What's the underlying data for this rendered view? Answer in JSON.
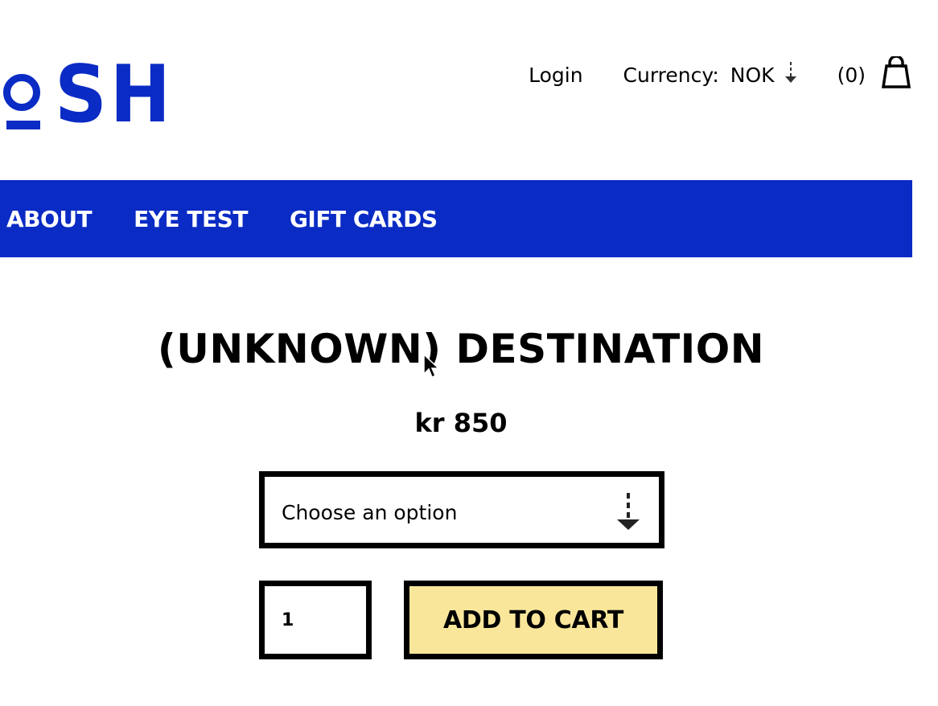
{
  "brand": {
    "logo_text": "SH",
    "color": "#0a2bc4"
  },
  "header": {
    "login_label": "Login",
    "currency_label": "Currency:",
    "currency_value": "NOK",
    "cart_count": "(0)"
  },
  "nav": {
    "items": [
      {
        "label": "ABOUT"
      },
      {
        "label": "EYE TEST"
      },
      {
        "label": "GIFT CARDS"
      }
    ]
  },
  "product": {
    "title": "(UNKNOWN) DESTINATION",
    "price": "kr 850",
    "option_placeholder": "Choose an option",
    "quantity": "1",
    "add_to_cart_label": "ADD TO CART",
    "button_color": "#fae69b"
  },
  "icons": {
    "currency_arrow": "arrow-down-icon",
    "cart": "shopping-bag-icon",
    "select_arrow": "dashed-arrow-down-icon",
    "cursor": "mouse-pointer-icon"
  }
}
